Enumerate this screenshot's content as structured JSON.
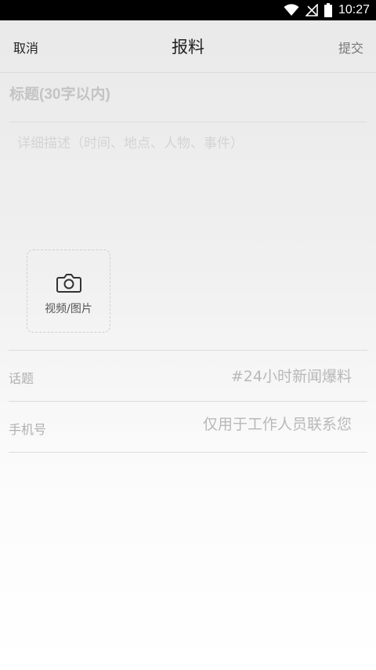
{
  "status_bar": {
    "time": "10:27",
    "icons": [
      "wifi-icon",
      "signal-off-icon",
      "battery-icon"
    ]
  },
  "nav": {
    "cancel_label": "取消",
    "title": "报料",
    "submit_label": "提交"
  },
  "form": {
    "title_placeholder": "标题(30字以内)",
    "description_placeholder": "详细描述（时间、地点、人物、事件）",
    "media_label": "视频/图片",
    "media_icon": "camera-icon",
    "topic_label": "话题",
    "topic_value": "#24小时新闻爆料",
    "phone_label": "手机号",
    "phone_placeholder": "仅用于工作人员联系您"
  }
}
